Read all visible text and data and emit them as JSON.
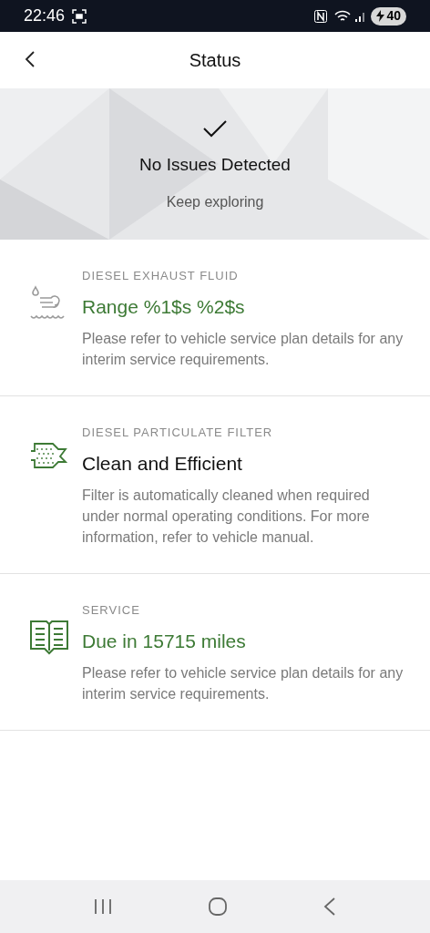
{
  "status_bar": {
    "time": "22:46",
    "battery": "40"
  },
  "header": {
    "title": "Status"
  },
  "banner": {
    "title": "No Issues Detected",
    "subtitle": "Keep exploring"
  },
  "items": [
    {
      "kind": "fluid",
      "icon_active": false,
      "title_green": true,
      "label": "DIESEL EXHAUST FLUID",
      "title": "Range %1$s %2$s",
      "description": "Please refer to vehicle service plan details for any interim service requirements."
    },
    {
      "kind": "filter",
      "icon_active": true,
      "title_green": false,
      "label": "DIESEL PARTICULATE FILTER",
      "title": "Clean and Efficient",
      "description": "Filter is automatically cleaned when required under normal operating conditions. For more information, refer to vehicle manual."
    },
    {
      "kind": "book",
      "icon_active": true,
      "title_green": true,
      "label": "SERVICE",
      "title": "Due in 15715 miles",
      "description": "Please refer to vehicle service plan details for any interim service requirements."
    }
  ]
}
